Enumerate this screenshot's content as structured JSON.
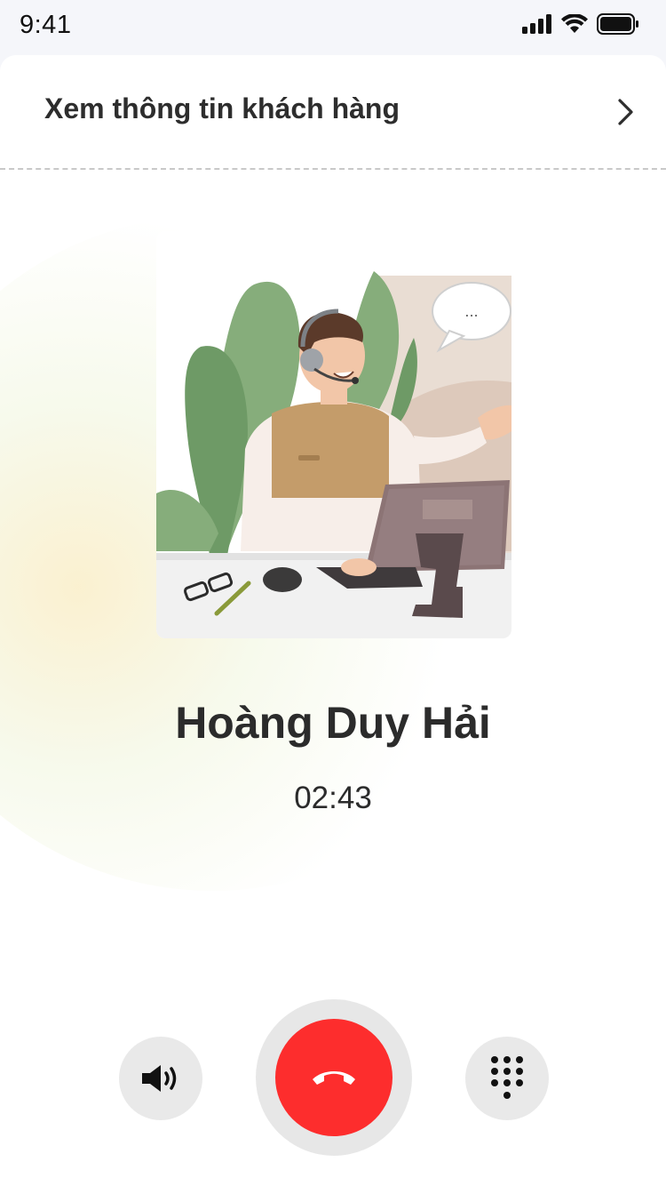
{
  "status_bar": {
    "time": "9:41",
    "icons": [
      "cellular-signal-icon",
      "wifi-icon",
      "battery-icon"
    ]
  },
  "customer_info": {
    "label": "Xem thông tin khách hàng",
    "icon": "chevron-right-icon"
  },
  "illustration": {
    "subject": "support-agent-with-headset-illustration",
    "speech_bubble_text": "..."
  },
  "call": {
    "caller_name": "Hoàng Duy Hải",
    "duration": "02:43"
  },
  "controls": {
    "speaker_icon": "speaker-icon",
    "end_call_icon": "hang-up-icon",
    "keypad_icon": "keypad-icon",
    "end_call_color": "#fd2d2d"
  }
}
